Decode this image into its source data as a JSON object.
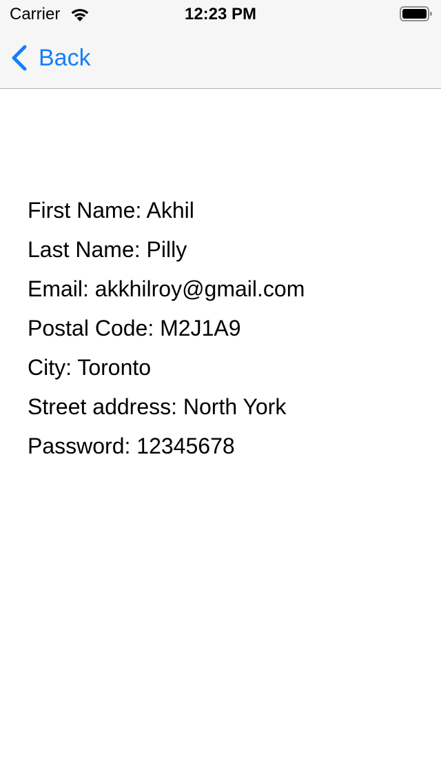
{
  "status_bar": {
    "carrier": "Carrier",
    "time": "12:23 PM"
  },
  "nav": {
    "back_label": "Back"
  },
  "details": [
    {
      "label": "First Name",
      "value": "Akhil",
      "text": "First Name: Akhil"
    },
    {
      "label": "Last Name",
      "value": "Pilly",
      "text": "Last Name: Pilly"
    },
    {
      "label": "Email",
      "value": "akkhilroy@gmail.com",
      "text": "Email: akkhilroy@gmail.com"
    },
    {
      "label": "Postal Code",
      "value": "M2J1A9",
      "text": "Postal Code: M2J1A9"
    },
    {
      "label": "City",
      "value": "Toronto",
      "text": "City: Toronto"
    },
    {
      "label": "Street address",
      "value": "North York",
      "text": "Street address: North York"
    },
    {
      "label": "Password",
      "value": "12345678",
      "text": "Password: 12345678"
    }
  ],
  "colors": {
    "accent": "#157efb",
    "bar_background": "#f6f6f6",
    "separator": "#b2b2b2",
    "text": "#000000"
  },
  "icons": {
    "wifi": "wifi-icon",
    "battery": "battery-icon",
    "back": "chevron-left-icon"
  }
}
